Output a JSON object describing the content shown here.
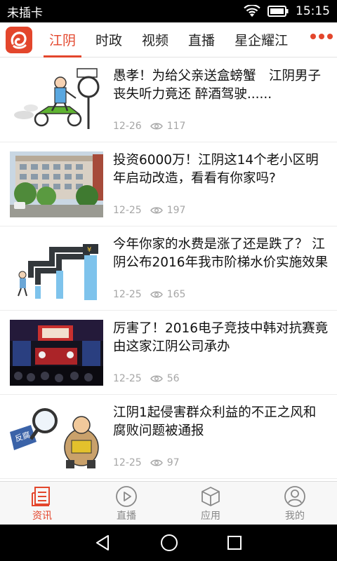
{
  "status_bar": {
    "carrier": "未插卡",
    "time": "15:15"
  },
  "header": {
    "brand_color": "#e3462c",
    "tabs": [
      {
        "label": "江阴",
        "active": true
      },
      {
        "label": "时政",
        "active": false
      },
      {
        "label": "视频",
        "active": false
      },
      {
        "label": "直播",
        "active": false
      },
      {
        "label": "星企耀江",
        "active": false
      }
    ]
  },
  "news": [
    {
      "title": "愚孝！为给父亲送盒螃蟹　江阴男子丧失听力竟还 醉酒驾驶......",
      "date": "12-26",
      "views": "117",
      "thumb": "cartoon-scooter"
    },
    {
      "title": "投资6000万！江阴这14个老小区明年启动改造，看看有你家吗?",
      "date": "12-25",
      "views": "197",
      "thumb": "residential-building"
    },
    {
      "title": "今年你家的水费是涨了还是跌了？ 江阴公布2016年我市阶梯水价实施效果",
      "date": "12-25",
      "views": "165",
      "thumb": "water-tap-cartoon"
    },
    {
      "title": "厉害了！2016电子竞技中韩对抗赛竟由这家江阴公司承办",
      "date": "12-25",
      "views": "56",
      "thumb": "esports-stage"
    },
    {
      "title": "江阴1起侵害群众利益的不正之风和腐败问题被通报",
      "date": "12-25",
      "views": "97",
      "thumb": "anti-corruption-cartoon"
    }
  ],
  "bottom_nav": [
    {
      "label": "资讯",
      "icon": "news-icon",
      "active": true
    },
    {
      "label": "直播",
      "icon": "play-icon",
      "active": false
    },
    {
      "label": "应用",
      "icon": "box-icon",
      "active": false
    },
    {
      "label": "我的",
      "icon": "user-icon",
      "active": false
    }
  ],
  "thumb_text": {
    "anti_corruption": "反腐"
  }
}
